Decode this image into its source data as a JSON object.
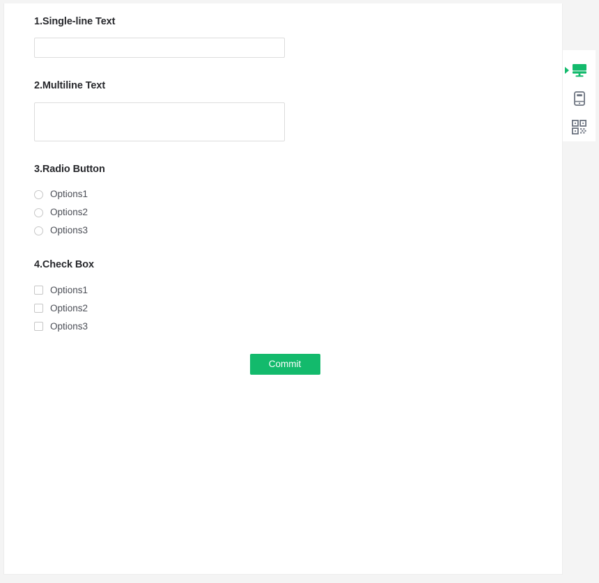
{
  "page": {
    "background_color": "#f4f4f4",
    "canvas_color": "#ffffff"
  },
  "form": {
    "fields": [
      {
        "label": "1.Single-line Text",
        "type": "text",
        "value": "",
        "placeholder": ""
      },
      {
        "label": "2.Multiline Text",
        "type": "textarea",
        "value": "",
        "placeholder": ""
      },
      {
        "label": "3.Radio Button",
        "type": "radio",
        "options": [
          "Options1",
          "Options2",
          "Options3"
        ]
      },
      {
        "label": "4.Check Box",
        "type": "checkbox",
        "options": [
          "Options1",
          "Options2",
          "Options3"
        ]
      }
    ],
    "submit": {
      "label": "Commit",
      "color": "#13ba6c",
      "text_color": "#ffffff"
    }
  },
  "device_sidebar": {
    "active_index": 0,
    "active_color": "#13ba6c",
    "inactive_color": "#6b727f",
    "items": [
      {
        "icon": "desktop-monitor-icon",
        "name": "desktop-preview",
        "active": true
      },
      {
        "icon": "mobile-device-icon",
        "name": "mobile-preview",
        "active": false
      },
      {
        "icon": "qr-code-icon",
        "name": "qr-code-preview",
        "active": false
      }
    ]
  }
}
